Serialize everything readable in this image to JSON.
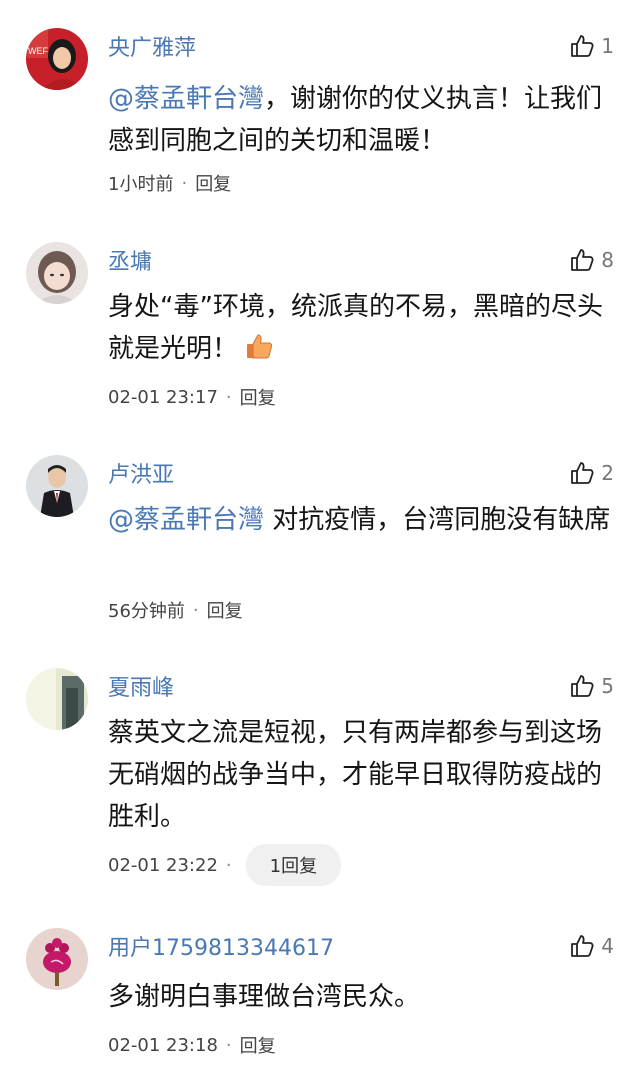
{
  "comments": [
    {
      "user": "央广雅萍",
      "likes": "1",
      "mention": "@蔡孟軒台灣",
      "text": "，谢谢你的仗义执言！让我们感到同胞之间的关切和温暖！",
      "time": "1小时前",
      "reply": "回复"
    },
    {
      "user": "丞墉",
      "likes": "8",
      "text": "身处“毒”环境，统派真的不易，黑暗的尽头就是光明！",
      "emoji": "thumbs-up-icon",
      "time": "02-01 23:17",
      "reply": "回复"
    },
    {
      "user": "卢洪亚",
      "likes": "2",
      "mention": "@蔡孟軒台灣",
      "text": " 对抗疫情，台湾同胞没有缺席",
      "time": "56分钟前",
      "reply": "回复"
    },
    {
      "user": "夏雨峰",
      "likes": "5",
      "text": "蔡英文之流是短视，只有两岸都参与到这场无硝烟的战争当中，才能早日取得防疫战的胜利。",
      "time": "02-01 23:22",
      "reply": "1回复"
    },
    {
      "user": "用户1759813344617",
      "likes": "4",
      "text": "多谢明白事理做台湾民众。",
      "time": "02-01 23:18",
      "reply": "回复"
    }
  ],
  "separator": "·",
  "colors": {
    "name": "#4a78b5",
    "mention": "#4a78b5",
    "meta": "#444444",
    "like": "#777777"
  }
}
